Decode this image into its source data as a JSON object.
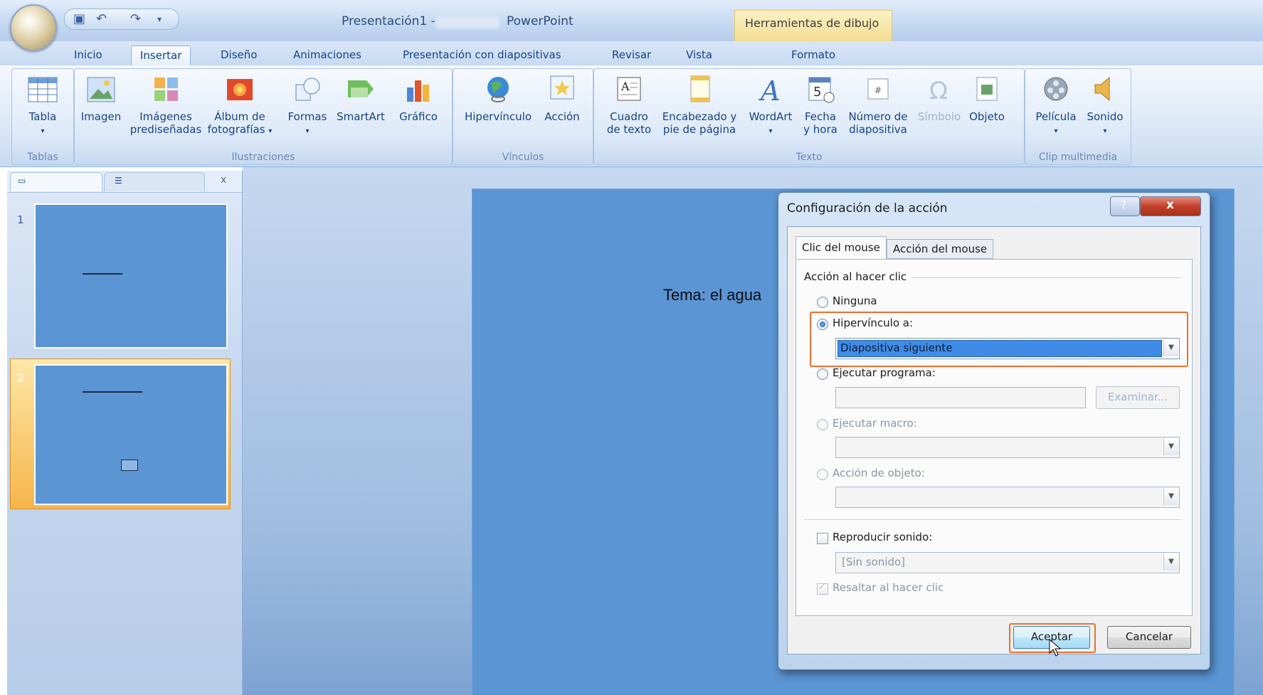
{
  "window": {
    "title": "Presentación1 -",
    "app_name": "PowerPoint",
    "context_tab": "Herramientas de dibujo"
  },
  "tabs": [
    {
      "label": "Inicio"
    },
    {
      "label": "Insertar",
      "active": true
    },
    {
      "label": "Diseño"
    },
    {
      "label": "Animaciones"
    },
    {
      "label": "Presentación con diapositivas"
    },
    {
      "label": "Revisar"
    },
    {
      "label": "Vista"
    },
    {
      "label": "Formato"
    }
  ],
  "ribbon": {
    "tablas": {
      "label": "Tablas",
      "tabla": "Tabla"
    },
    "ilustraciones": {
      "label": "Ilustraciones",
      "imagen": "Imagen",
      "imagenes_1": "Imágenes",
      "imagenes_2": "prediseñadas",
      "album_1": "Álbum de",
      "album_2": "fotografías",
      "formas": "Formas",
      "smartart": "SmartArt",
      "grafico": "Gráfico"
    },
    "vinculos": {
      "label": "Vínculos",
      "hipervinculo": "Hipervínculo",
      "accion": "Acción"
    },
    "texto": {
      "label": "Texto",
      "cuadro_1": "Cuadro",
      "cuadro_2": "de texto",
      "encabezado_1": "Encabezado y",
      "encabezado_2": "pie de página",
      "wordart": "WordArt",
      "fecha_1": "Fecha",
      "fecha_2": "y hora",
      "numero_1": "Número de",
      "numero_2": "diapositiva",
      "simbolo": "Símbolo",
      "objeto": "Objeto"
    },
    "clip": {
      "label": "Clip multimedia",
      "pelicula": "Película",
      "sonido": "Sonido"
    }
  },
  "slides_panel": {
    "slides": [
      {
        "number": "1"
      },
      {
        "number": "2"
      }
    ]
  },
  "slide": {
    "text": "Tema: el agua"
  },
  "dialog": {
    "title": "Configuración de la acción",
    "tab_click": "Clic del mouse",
    "tab_hover": "Acción del mouse",
    "section_label": "Acción al hacer clic",
    "opt_none": "Ninguna",
    "opt_hyperlink": "Hipervínculo a:",
    "hyperlink_value": "Diapositiva siguiente",
    "opt_program": "Ejecutar programa:",
    "browse": "Examinar...",
    "opt_macro": "Ejecutar macro:",
    "opt_object": "Acción de objeto:",
    "play_sound": "Reproducir sonido:",
    "sound_value": "[Sin sonido]",
    "highlight": "Resaltar al hacer clic",
    "ok": "Aceptar",
    "cancel": "Cancelar"
  },
  "colors": {
    "accent_highlight": "#e97132",
    "slide_bg": "#5b95d4"
  }
}
